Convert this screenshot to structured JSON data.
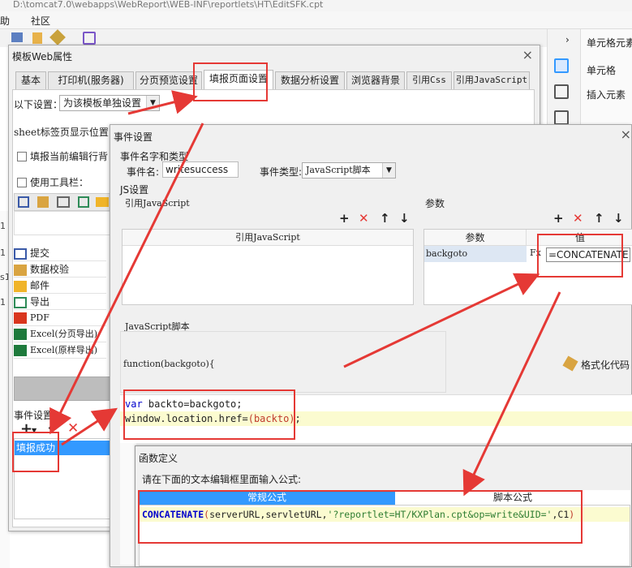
{
  "pathbar": {
    "path": "D:\\tomcat7.0\\webapps\\WebReport\\WEB-INF\\reportlets\\HT\\EditSFK.cpt"
  },
  "menubar": {
    "items": [
      "助",
      "社区"
    ]
  },
  "right_panel": {
    "title": "单元格元素",
    "cell": "单元格",
    "insert": "插入元素"
  },
  "web_dialog": {
    "title": "模板Web属性",
    "tabs": [
      "基本",
      "打印机(服务器)",
      "分页预览设置",
      "填报页面设置",
      "数据分析设置",
      "浏览器背景",
      "引用Css",
      "引用JavaScript"
    ],
    "active_tab": 3,
    "settings_label": "以下设置：",
    "settings_value": "为该模板单独设置",
    "sheet_label": "sheet标签页显示位置：",
    "highlight_label": "填报当前编辑行背",
    "toolbar_label": "使用工具栏：",
    "list_items": [
      {
        "icon": "submit-icon",
        "label": "提交"
      },
      {
        "icon": "verify-icon",
        "label": "数据校验"
      },
      {
        "icon": "mail-icon",
        "label": "邮件"
      },
      {
        "icon": "export-icon",
        "label": "导出"
      },
      {
        "icon": "pdf-icon",
        "label": "PDF"
      },
      {
        "icon": "excel-icon",
        "label": "Excel(分页导出)"
      },
      {
        "icon": "excel-icon",
        "label": "Excel(原样导出)"
      }
    ],
    "event_label": "事件设置：",
    "event_item": "填报成功"
  },
  "event_dialog": {
    "title": "事件设置",
    "name_type_section": "事件名字和类型",
    "name_label": "事件名:",
    "name_value": "writesuccess",
    "type_label": "事件类型:",
    "type_value": "JavaScript脚本",
    "js_section": "JS设置",
    "ref_js_label": "引用JavaScript",
    "ref_js_col": "引用JavaScript",
    "params_label": "参数",
    "params_cols": [
      "参数",
      "值"
    ],
    "param_name": "backgoto",
    "param_fx": "Fx",
    "param_value": "=CONCATENATE",
    "script_label": "JavaScript脚本",
    "function_sig": "function(backgoto){",
    "format_label": "格式化代码",
    "code_kw": "var",
    "code_line1_rest": " backto=backgoto;",
    "code_line2_a": "window.location.href=",
    "code_line2_b": "(backto)",
    "code_line2_c": ";"
  },
  "func_dialog": {
    "title": "函数定义",
    "prompt": "请在下面的文本编辑框里面输入公式:",
    "tabs": [
      "常规公式",
      "脚本公式"
    ],
    "active_tab": 0,
    "formula_fn": "CONCATENATE",
    "formula_open": "(",
    "formula_args": "serverURL,servletURL,",
    "formula_str": "'?reportlet=HT/KXPlan.cpt&op=write&UID='",
    "formula_tail": ",C1",
    "formula_close": ")"
  },
  "grid_ticks": [
    "1",
    "1",
    "s1",
    "1"
  ],
  "colors": {
    "accent": "#3399ff",
    "annotation": "#e53935",
    "selection": "#3399ff"
  }
}
